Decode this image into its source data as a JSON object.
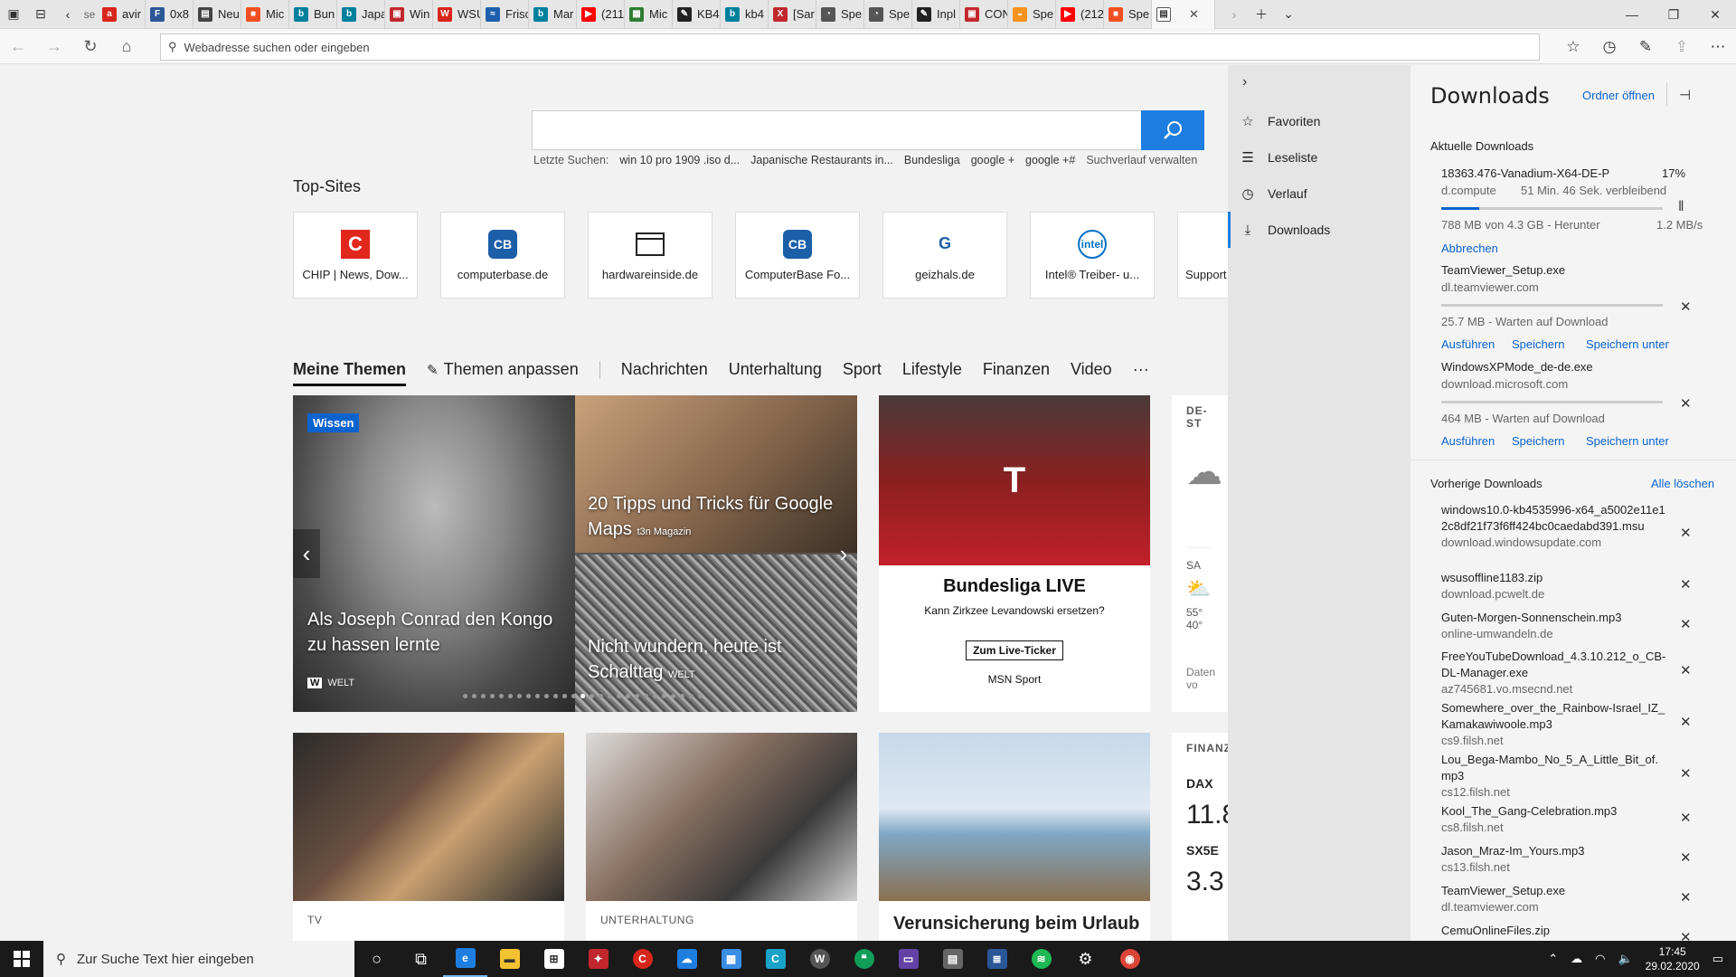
{
  "tabs": [
    {
      "label": "avir",
      "color": "#d9261c",
      "glyph": "a"
    },
    {
      "label": "0x8",
      "color": "#2b5797",
      "glyph": "F"
    },
    {
      "label": "Neu",
      "color": "#444444",
      "glyph": "▤"
    },
    {
      "label": "Mic",
      "color": "#f25022",
      "glyph": "■"
    },
    {
      "label": "Bun",
      "color": "#00809d",
      "glyph": "b"
    },
    {
      "label": "Japa",
      "color": "#00809d",
      "glyph": "b"
    },
    {
      "label": "Win",
      "color": "#c1272d",
      "glyph": "▣"
    },
    {
      "label": "WSU",
      "color": "#d9261c",
      "glyph": "W"
    },
    {
      "label": "Frisc",
      "color": "#1e5fae",
      "glyph": "≈"
    },
    {
      "label": "Mar",
      "color": "#00809d",
      "glyph": "b"
    },
    {
      "label": "(211",
      "color": "#ff0000",
      "glyph": "▶"
    },
    {
      "label": "Mic",
      "color": "#2e7d32",
      "glyph": "▦"
    },
    {
      "label": "KB4",
      "color": "#222222",
      "glyph": "✎"
    },
    {
      "label": "kb4",
      "color": "#00809d",
      "glyph": "b"
    },
    {
      "label": "[Sar",
      "color": "#c1272d",
      "glyph": "X"
    },
    {
      "label": "Spe",
      "color": "#555555",
      "glyph": "◔"
    },
    {
      "label": "Spe",
      "color": "#555555",
      "glyph": "◔"
    },
    {
      "label": "Inpl",
      "color": "#222222",
      "glyph": "✎"
    },
    {
      "label": "CON",
      "color": "#c1272d",
      "glyph": "▣"
    },
    {
      "label": "Spe",
      "color": "#f7931e",
      "glyph": "◒"
    },
    {
      "label": "(212",
      "color": "#ff0000",
      "glyph": "▶"
    },
    {
      "label": "Spe",
      "color": "#f25022",
      "glyph": "■"
    }
  ],
  "active_tab_label": "",
  "address": {
    "placeholder": "Webadresse suchen oder eingeben"
  },
  "search": {
    "recent_label": "Letzte Suchen:",
    "recent": [
      "win 10 pro 1909 .iso d...",
      "Japanische Restaurants in...",
      "Bundesliga",
      "google +",
      "google +#"
    ],
    "history_link": "Suchverlauf verwalten"
  },
  "topsites": {
    "title": "Top-Sites",
    "items": [
      {
        "label": "CHIP | News, Dow...",
        "logo": "C",
        "color": "#e1261c"
      },
      {
        "label": "computerbase.de",
        "logo": "CB",
        "color": "#1b5fa8"
      },
      {
        "label": "hardwareinside.de",
        "logo": "▭",
        "color": "#222222"
      },
      {
        "label": "ComputerBase Fo...",
        "logo": "CB",
        "color": "#1b5fa8"
      },
      {
        "label": "geizhals.de",
        "logo": "G",
        "color": "#1b5fa8"
      },
      {
        "label": "Intel® Treiber- u...",
        "logo": "intel",
        "color": "#0071c5"
      },
      {
        "label": "Support",
        "logo": "",
        "color": "#888888"
      }
    ]
  },
  "themes": {
    "selected": "Meine Themen",
    "customize": "Themen anpassen",
    "items": [
      "Nachrichten",
      "Unterhaltung",
      "Sport",
      "Lifestyle",
      "Finanzen",
      "Video"
    ],
    "more": "···"
  },
  "hero": {
    "badge": "Wissen",
    "main_caption": "Als Joseph Conrad den Kongo zu hassen lernte",
    "main_source": "WELT",
    "tr_caption": "20 Tipps und Tricks für Google Maps",
    "tr_source": "t3n Magazin",
    "br_caption": "Nicht wundern, heute ist Schalttag",
    "br_source": "WELT"
  },
  "sport_card": {
    "title": "Bundesliga LIVE",
    "subtitle": "Kann Zirkzee Levandowski ersetzen?",
    "button": "Zum Live-Ticker",
    "source": "MSN Sport"
  },
  "weather": {
    "header": "DE-ST",
    "day": "SA",
    "high": "55°",
    "low": "40°",
    "footer": "Daten vo"
  },
  "finance": {
    "header": "FINANZ",
    "idx1": "DAX",
    "val1": "11.8",
    "idx2": "SX5E",
    "val2": "3.3"
  },
  "bottom_cards": [
    {
      "category": "TV",
      "title": ""
    },
    {
      "category": "UNTERHALTUNG",
      "title": ""
    },
    {
      "category": "",
      "title": "Verunsicherung beim Urlaub"
    }
  ],
  "hub": {
    "items": [
      "Favoriten",
      "Leseliste",
      "Verlauf",
      "Downloads"
    ]
  },
  "downloads": {
    "title": "Downloads",
    "open_folder": "Ordner öffnen",
    "current_label": "Aktuelle Downloads",
    "current": [
      {
        "name": "18363.476-Vanadium-X64-DE-P",
        "percent": "17%",
        "host": "d.compute",
        "remaining": "51 Min. 46 Sek. verbleibend",
        "size": "788 MB von 4.3 GB - Herunter",
        "speed": "1.2 MB/s",
        "progress": 0.17,
        "action": "Abbrechen"
      },
      {
        "name": "TeamViewer_Setup.exe",
        "host": "dl.teamviewer.com",
        "status": "25.7 MB - Warten auf Download",
        "actions": [
          "Ausführen",
          "Speichern",
          "Speichern unter"
        ]
      },
      {
        "name": "WindowsXPMode_de-de.exe",
        "host": "download.microsoft.com",
        "status": "464 MB - Warten auf Download",
        "actions": [
          "Ausführen",
          "Speichern",
          "Speichern unter"
        ]
      }
    ],
    "previous_label": "Vorherige Downloads",
    "clear_all": "Alle löschen",
    "previous": [
      {
        "name": "windows10.0-kb4535996-x64_a5002e11e12c8df21f73f6ff424bc0caedabd391.msu",
        "host": "download.windowsupdate.com"
      },
      {
        "name": "wsusoffline1183.zip",
        "host": "download.pcwelt.de"
      },
      {
        "name": "Guten-Morgen-Sonnenschein.mp3",
        "host": "online-umwandeln.de"
      },
      {
        "name": "FreeYouTubeDownload_4.3.10.212_o_CB-DL-Manager.exe",
        "host": "az745681.vo.msecnd.net"
      },
      {
        "name": "Somewhere_over_the_Rainbow-Israel_IZ_Kamakawiwoole.mp3",
        "host": "cs9.filsh.net"
      },
      {
        "name": "Lou_Bega-Mambo_No_5_A_Little_Bit_of.mp3",
        "host": "cs12.filsh.net"
      },
      {
        "name": "Kool_The_Gang-Celebration.mp3",
        "host": "cs8.filsh.net"
      },
      {
        "name": "Jason_Mraz-Im_Yours.mp3",
        "host": "cs13.filsh.net"
      },
      {
        "name": "TeamViewer_Setup.exe",
        "host": "dl.teamviewer.com"
      },
      {
        "name": "CemuOnlineFiles.zip",
        "host": ""
      }
    ]
  },
  "taskbar": {
    "search_placeholder": "Zur Suche Text hier eingeben",
    "time": "17:45",
    "date": "29.02.2020"
  }
}
